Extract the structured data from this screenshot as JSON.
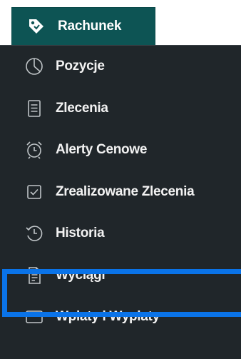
{
  "tab": {
    "label": "Rachunek",
    "icon": "tag-icon",
    "bg_color": "#0d5454"
  },
  "menu": {
    "bg_color": "#20262a",
    "items": [
      {
        "label": "Pozycje",
        "icon": "pie-chart-icon"
      },
      {
        "label": "Zlecenia",
        "icon": "document-icon"
      },
      {
        "label": "Alerty Cenowe",
        "icon": "alarm-clock-icon"
      },
      {
        "label": "Zrealizowane Zlecenia",
        "icon": "checkbox-icon"
      },
      {
        "label": "Historia",
        "icon": "history-icon"
      },
      {
        "label": "Wyciągi",
        "icon": "statement-icon",
        "highlighted": true
      },
      {
        "label": "Wpłaty i Wypłaty",
        "icon": "card-icon"
      }
    ]
  },
  "highlight_color": "#0a73e8"
}
